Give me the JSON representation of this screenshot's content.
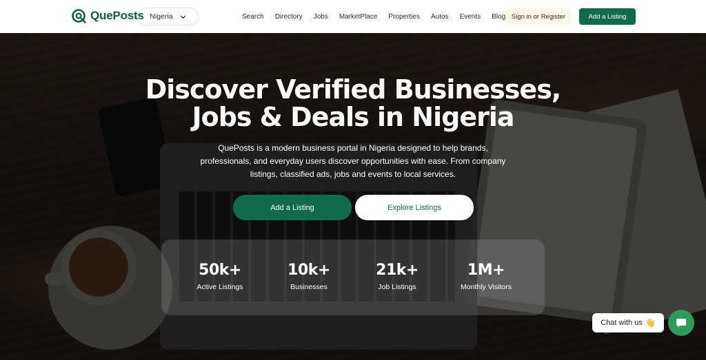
{
  "brand": {
    "name": "QuePosts",
    "color": "#0f6b4c"
  },
  "header": {
    "country": "Nigeria",
    "menu": [
      "Search",
      "Directory",
      "Jobs",
      "MarketPlace",
      "Properties",
      "Autos",
      "Events",
      "Blog"
    ],
    "signin_label": "Sign in or Register",
    "add_listing_label": "Add a Listing"
  },
  "hero": {
    "headline_line1": "Discover Verified Businesses,",
    "headline_line2": "Jobs & Deals in Nigeria",
    "description": "QuePosts is a modern business portal in Nigeria designed to help brands, professionals, and everyday users discover opportunities with ease. From company listings, classified ads, jobs and events to local services.",
    "primary_button": "Add a Listing",
    "secondary_button": "Explore Listings"
  },
  "stats": [
    {
      "value": "50k+",
      "label": "Active Listings"
    },
    {
      "value": "10k+",
      "label": "Businesses"
    },
    {
      "value": "21k+",
      "label": "Job Listings"
    },
    {
      "value": "1M+",
      "label": "Monthly Visitors"
    }
  ],
  "chat": {
    "label": "Chat with us",
    "emoji": "👋"
  },
  "icons": {
    "logo": "quepost-logo-icon",
    "dropdown": "chevron-down-icon",
    "chat": "chat-bubble-icon"
  }
}
